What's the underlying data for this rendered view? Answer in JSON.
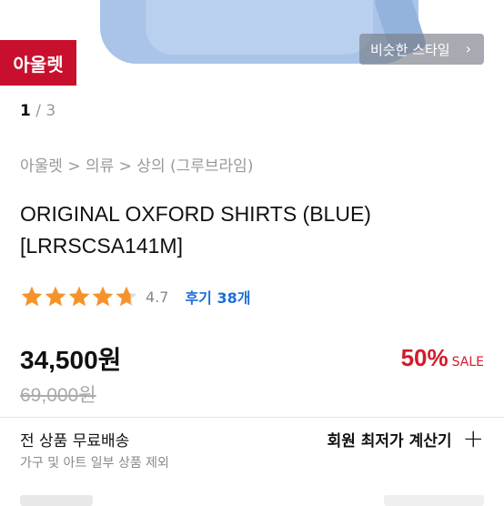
{
  "hero": {
    "badge": "아울렛",
    "similar_style_label": "비슷한 스타일",
    "similar_chevron": "›"
  },
  "pager": {
    "current": "1",
    "separator": " / ",
    "total": "3"
  },
  "breadcrumb": "아울렛 > 의류 > 상의 (그루브라임)",
  "product": {
    "title_line1": "ORIGINAL OXFORD SHIRTS (BLUE)",
    "title_line2": "[LRRSCSA141M]",
    "rating_value": "4.7",
    "rating_stars": 4.7,
    "reviews_label": "후기 38개",
    "price": "34,500원",
    "original_price": "69,000원",
    "discount_pct": "50%",
    "discount_label": "SALE"
  },
  "shipping": {
    "title": "전 상품 무료배송",
    "subtitle": "가구 및 아트 일부 상품 제외",
    "calc_label": "회원 최저가 계산기",
    "calc_icon": "plus-icon"
  },
  "colors": {
    "badge_red": "#c8102e",
    "sale_red": "#d41a2a",
    "star_orange": "#f5932a",
    "link_blue": "#1e6fd9"
  }
}
